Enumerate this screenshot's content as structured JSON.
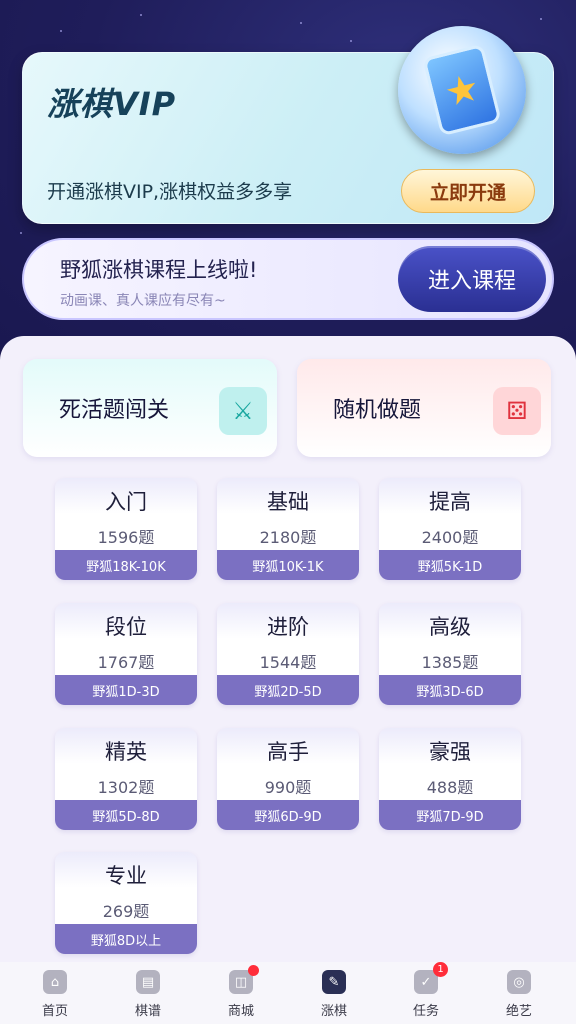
{
  "vip": {
    "title": "涨棋VIP",
    "description": "开通涨棋VIP,涨棋权益多多享",
    "button": "立即开通"
  },
  "course": {
    "title": "野狐涨棋课程上线啦!",
    "subtitle": "动画课、真人课应有尽有~",
    "button": "进入课程"
  },
  "modes": [
    {
      "label": "死活题闯关",
      "icon": "crossed-swords-icon"
    },
    {
      "label": "随机做题",
      "icon": "dice-icon"
    }
  ],
  "levels": [
    {
      "name": "入门",
      "count": "1596题",
      "rank": "野狐18K-10K"
    },
    {
      "name": "基础",
      "count": "2180题",
      "rank": "野狐10K-1K"
    },
    {
      "name": "提高",
      "count": "2400题",
      "rank": "野狐5K-1D"
    },
    {
      "name": "段位",
      "count": "1767题",
      "rank": "野狐1D-3D"
    },
    {
      "name": "进阶",
      "count": "1544题",
      "rank": "野狐2D-5D"
    },
    {
      "name": "高级",
      "count": "1385题",
      "rank": "野狐3D-6D"
    },
    {
      "name": "精英",
      "count": "1302题",
      "rank": "野狐5D-8D"
    },
    {
      "name": "高手",
      "count": "990题",
      "rank": "野狐6D-9D"
    },
    {
      "name": "豪强",
      "count": "488题",
      "rank": "野狐7D-9D"
    },
    {
      "name": "专业",
      "count": "269题",
      "rank": "野狐8D以上"
    }
  ],
  "nav": [
    {
      "label": "首页",
      "icon": "home-icon"
    },
    {
      "label": "棋谱",
      "icon": "record-book-icon"
    },
    {
      "label": "商城",
      "icon": "shopping-bag-icon",
      "dot": true
    },
    {
      "label": "涨棋",
      "icon": "pencil-icon",
      "active": true
    },
    {
      "label": "任务",
      "icon": "task-check-icon",
      "badge": "1"
    },
    {
      "label": "绝艺",
      "icon": "ai-icon"
    }
  ]
}
